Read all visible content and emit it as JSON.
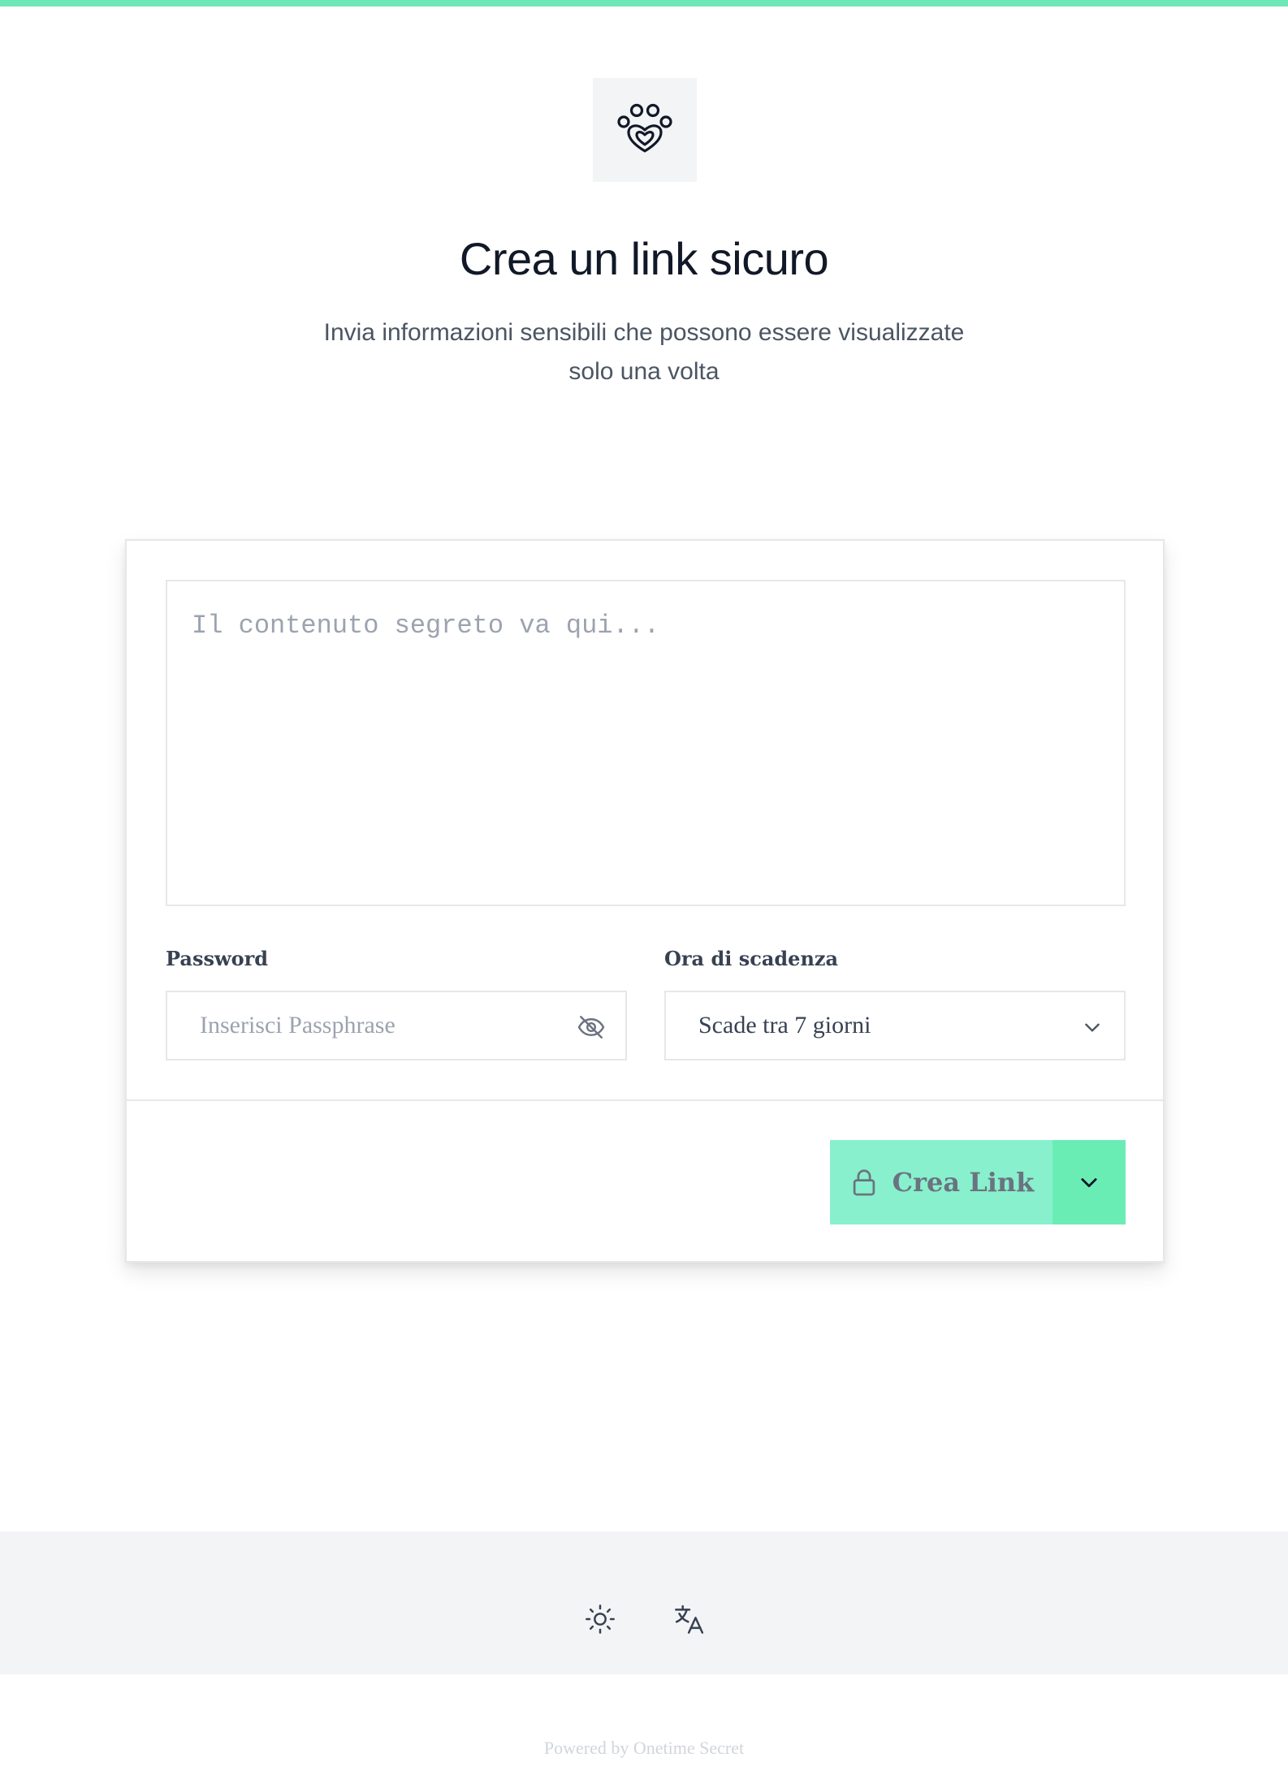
{
  "header": {
    "title": "Crea un link sicuro",
    "subtitle_line1": "Invia informazioni sensibili che possono essere visualizzate",
    "subtitle_line2": "solo una volta"
  },
  "form": {
    "secret_placeholder": "Il contenuto segreto va qui...",
    "password_label": "Password",
    "password_placeholder": "Inserisci Passphrase",
    "expiry_label": "Ora di scadenza",
    "expiry_value": "Scade tra 7 giorni",
    "create_button_label": "Crea Link"
  },
  "footer": {
    "powered_by": "Powered by Onetime Secret"
  },
  "colors": {
    "accent_bar": "#6ee7b7",
    "button_main": "#88f0cc",
    "button_menu": "#6aedb5",
    "footer_bg": "#f3f4f6"
  },
  "icons": {
    "logo": "paw-heart-icon",
    "password_toggle": "eye-off-icon",
    "expiry_dropdown": "chevron-down-icon",
    "create_button": "lock-icon",
    "create_menu": "chevron-down-icon",
    "theme": "sun-icon",
    "language": "translate-icon"
  }
}
